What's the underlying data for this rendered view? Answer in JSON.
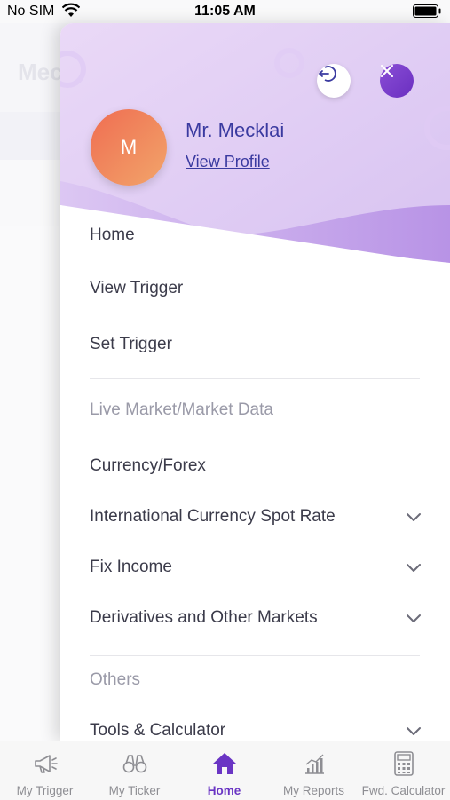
{
  "status_bar": {
    "carrier": "No SIM",
    "time": "11:05 AM"
  },
  "background": {
    "title": "Mec"
  },
  "drawer": {
    "user_initial": "M",
    "user_name": "Mr. Mecklai",
    "view_profile_label": "View Profile",
    "items": [
      {
        "label": "Home"
      },
      {
        "label": "View Trigger"
      },
      {
        "label": "Set Trigger"
      }
    ],
    "section_market": "Live Market/Market Data",
    "market_items": [
      {
        "label": "Currency/Forex",
        "expandable": false
      },
      {
        "label": "International Currency Spot Rate",
        "expandable": true
      },
      {
        "label": "Fix Income",
        "expandable": true
      },
      {
        "label": "Derivatives and Other Markets",
        "expandable": true
      }
    ],
    "section_others": "Others",
    "others_items": [
      {
        "label": "Tools & Calculator",
        "expandable": true
      }
    ]
  },
  "tabbar": {
    "tabs": [
      {
        "label": "My Trigger",
        "icon": "megaphone-icon",
        "active": false
      },
      {
        "label": "My Ticker",
        "icon": "binoculars-icon",
        "active": false
      },
      {
        "label": "Home",
        "icon": "home-icon",
        "active": true
      },
      {
        "label": "My Reports",
        "icon": "chart-icon",
        "active": false
      },
      {
        "label": "Fwd. Calculator",
        "icon": "calculator-icon",
        "active": false
      }
    ]
  },
  "colors": {
    "accent": "#6a35c4",
    "avatar": "#ef7a58",
    "header_tint": "#e7d8f6"
  }
}
